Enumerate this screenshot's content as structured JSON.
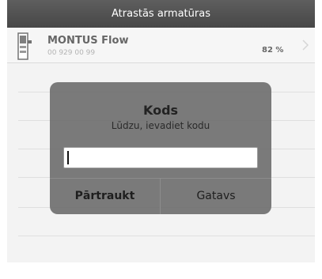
{
  "header": {
    "title": "Atrastās armatūras"
  },
  "device": {
    "name": "MONTUS Flow",
    "code": "00 929 00 99",
    "value": "82 %",
    "icon": "faucet-device-icon"
  },
  "dialog": {
    "title": "Kods",
    "message": "Lūdzu, ievadiet kodu",
    "input_value": "",
    "cancel_label": "Pārtraukt",
    "done_label": "Gatavs"
  },
  "colors": {
    "titlebar": "#4f4f4f",
    "dialog_bg": "#707070",
    "list_bg": "#efefef"
  }
}
